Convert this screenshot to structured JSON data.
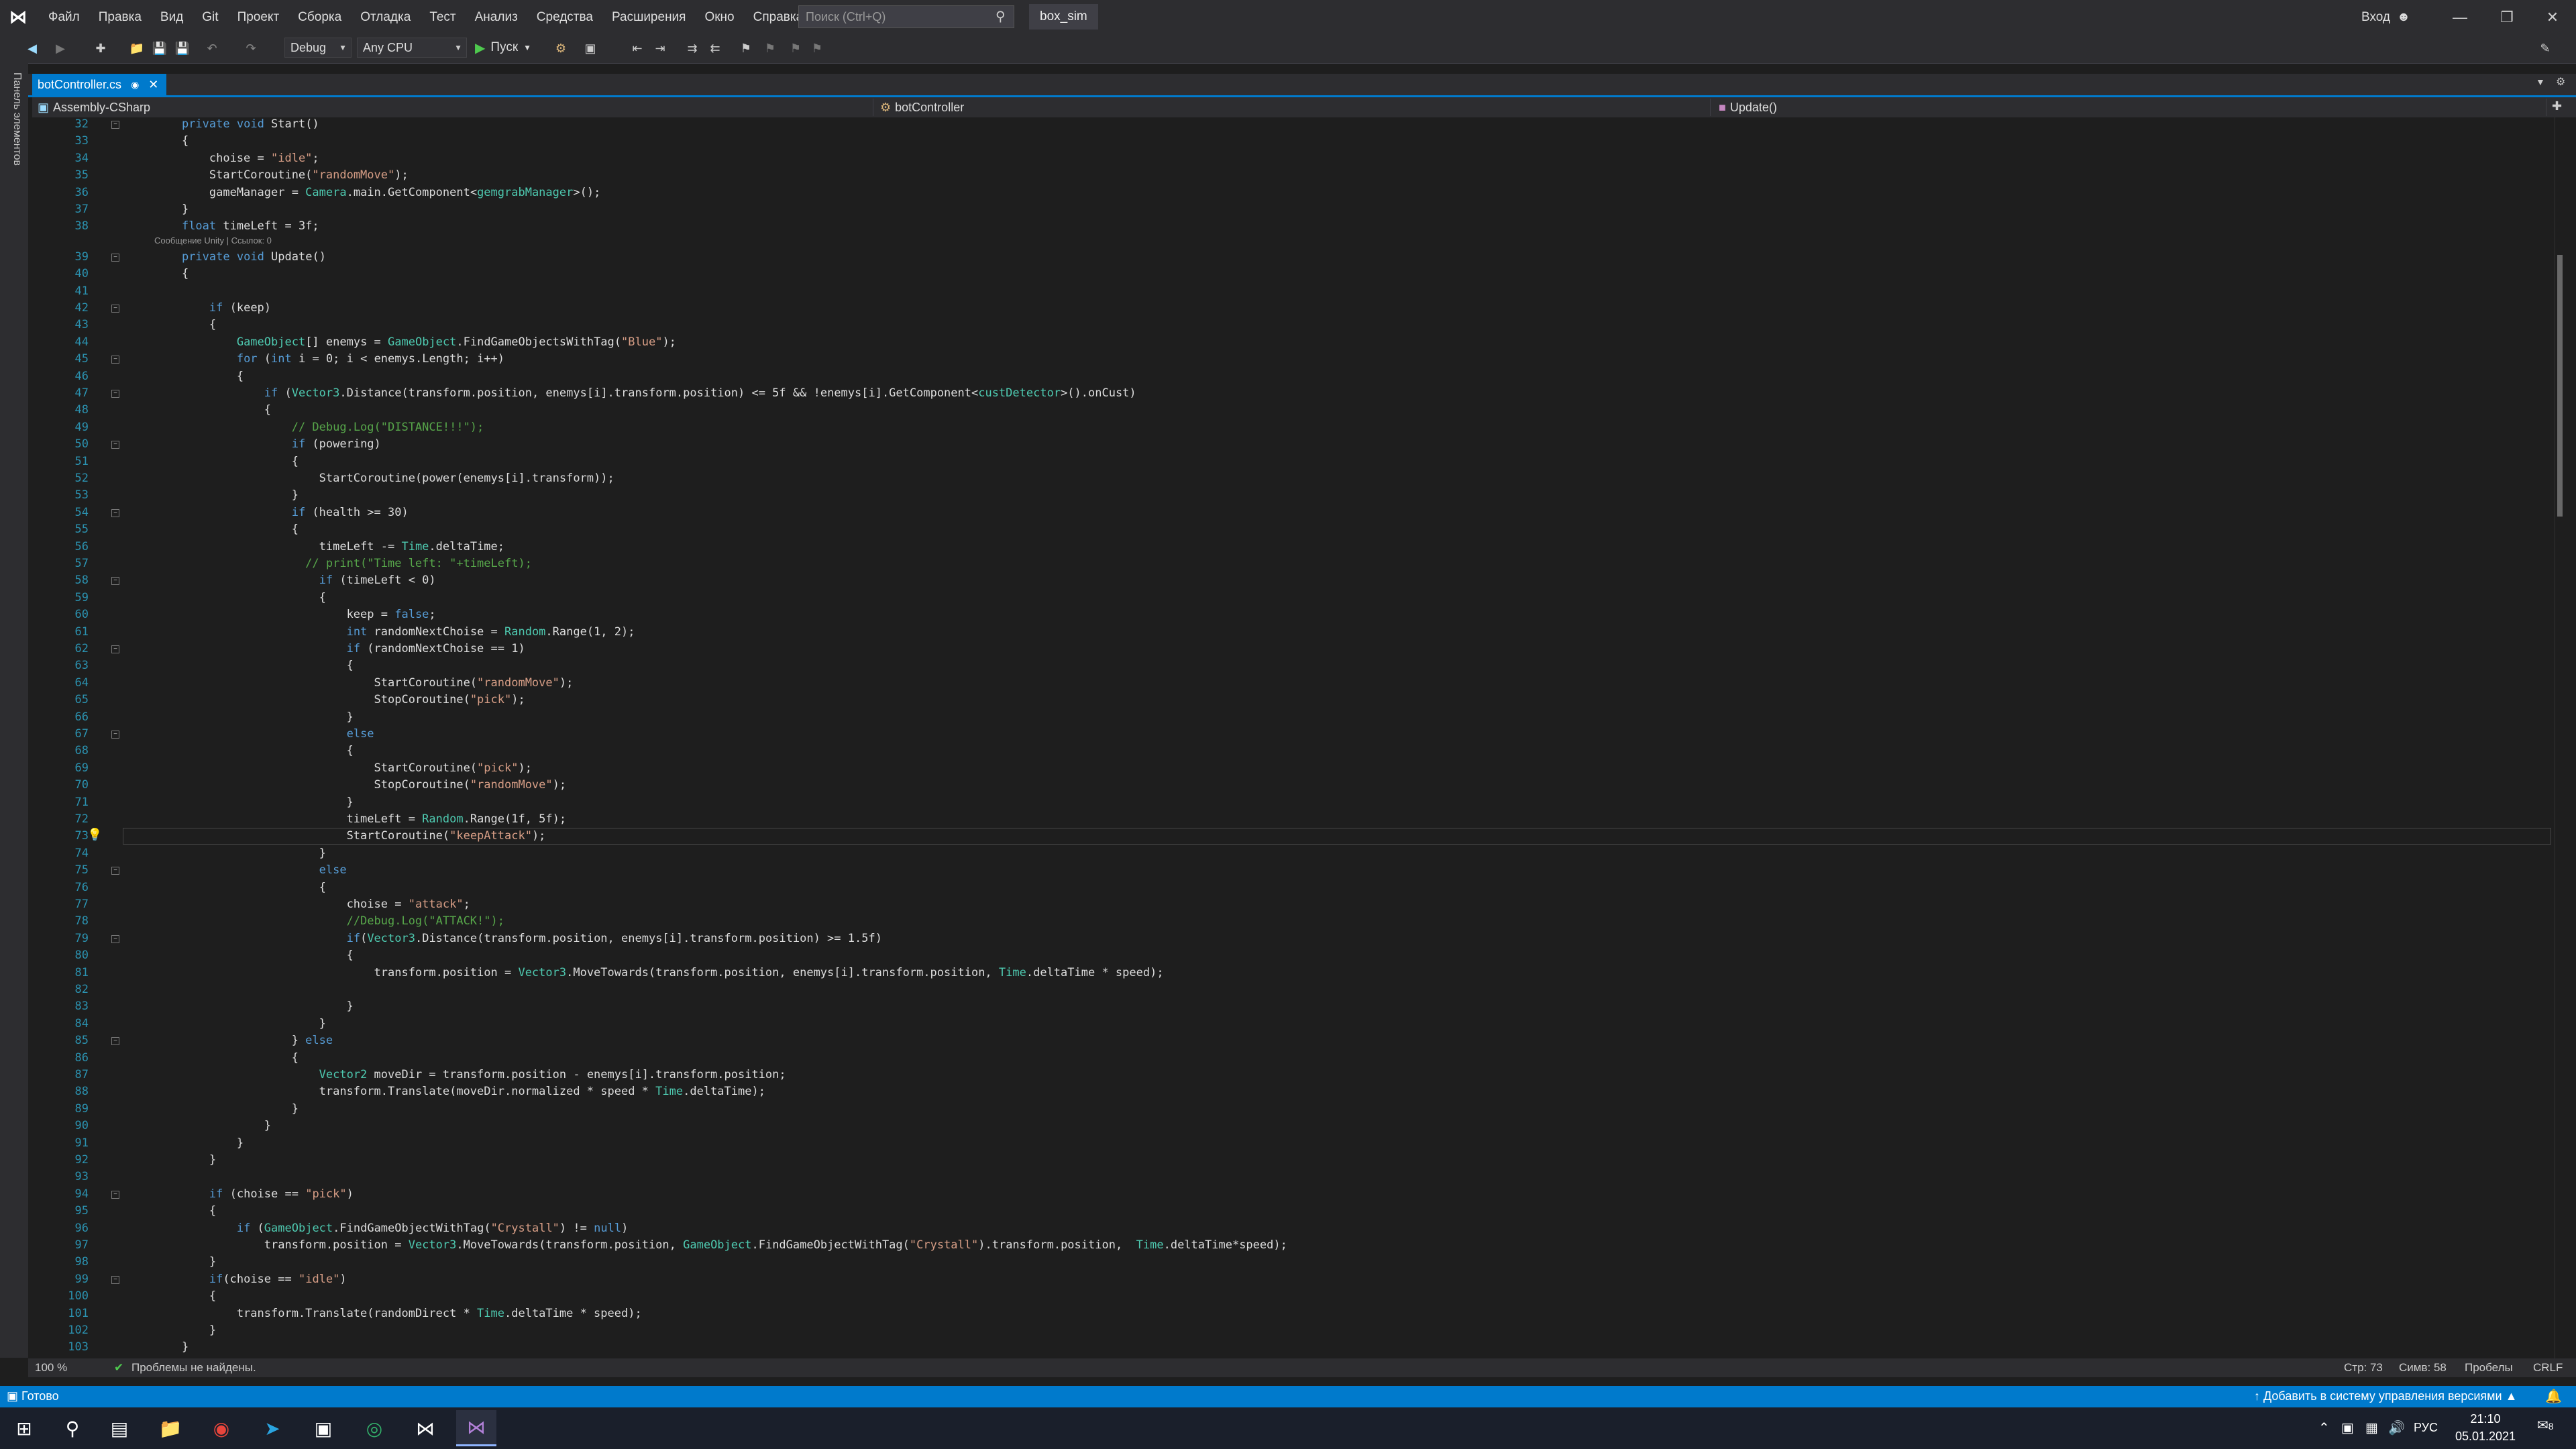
{
  "titlebar": {
    "menu": [
      "Файл",
      "Правка",
      "Вид",
      "Git",
      "Проект",
      "Сборка",
      "Отладка",
      "Тест",
      "Анализ",
      "Средства",
      "Расширения",
      "Окно",
      "Справка"
    ],
    "search_placeholder": "Поиск (Ctrl+Q)",
    "solution_name": "box_sim",
    "signin_label": "Вход"
  },
  "toolbar": {
    "config": "Debug",
    "platform": "Any CPU",
    "run_label": "Пуск"
  },
  "side_panel_label": "Панель элементов",
  "tabs": [
    {
      "label": "botController.cs",
      "active": true
    }
  ],
  "navbar": {
    "project": "Assembly-CSharp",
    "class": "botController",
    "member": "Update()"
  },
  "editor": {
    "codelens": "Сообщение Unity | Ссылок: 0",
    "current_line": 73,
    "lines": [
      {
        "n": "32",
        "t": "    private void Start()"
      },
      {
        "n": "33",
        "t": "    {"
      },
      {
        "n": "34",
        "t": "        choise = \"idle\";"
      },
      {
        "n": "35",
        "t": "        StartCoroutine(\"randomMove\");"
      },
      {
        "n": "36",
        "t": "        gameManager = Camera.main.GetComponent<gemgrabManager>();"
      },
      {
        "n": "37",
        "t": "    }"
      },
      {
        "n": "38",
        "t": "    float timeLeft = 3f;"
      },
      {
        "n": "39",
        "t": "    private void Update()"
      },
      {
        "n": "40",
        "t": "    {"
      },
      {
        "n": "41",
        "t": ""
      },
      {
        "n": "42",
        "t": "        if (keep)"
      },
      {
        "n": "43",
        "t": "        {"
      },
      {
        "n": "44",
        "t": "            GameObject[] enemys = GameObject.FindGameObjectsWithTag(\"Blue\");"
      },
      {
        "n": "45",
        "t": "            for (int i = 0; i < enemys.Length; i++)"
      },
      {
        "n": "46",
        "t": "            {"
      },
      {
        "n": "47",
        "t": "                if (Vector3.Distance(transform.position, enemys[i].transform.position) <= 5f && !enemys[i].GetComponent<custDetector>().onCust)"
      },
      {
        "n": "48",
        "t": "                {"
      },
      {
        "n": "49",
        "t": "                    // Debug.Log(\"DISTANCE!!!\");"
      },
      {
        "n": "50",
        "t": "                    if (powering)"
      },
      {
        "n": "51",
        "t": "                    {"
      },
      {
        "n": "52",
        "t": "                        StartCoroutine(power(enemys[i].transform));"
      },
      {
        "n": "53",
        "t": "                    }"
      },
      {
        "n": "54",
        "t": "                    if (health >= 30)"
      },
      {
        "n": "55",
        "t": "                    {"
      },
      {
        "n": "56",
        "t": "                        timeLeft -= Time.deltaTime;"
      },
      {
        "n": "57",
        "t": "                      // print(\"Time left: \"+timeLeft);"
      },
      {
        "n": "58",
        "t": "                        if (timeLeft < 0)"
      },
      {
        "n": "59",
        "t": "                        {"
      },
      {
        "n": "60",
        "t": "                            keep = false;"
      },
      {
        "n": "61",
        "t": "                            int randomNextChoise = Random.Range(1, 2);"
      },
      {
        "n": "62",
        "t": "                            if (randomNextChoise == 1)"
      },
      {
        "n": "63",
        "t": "                            {"
      },
      {
        "n": "64",
        "t": "                                StartCoroutine(\"randomMove\");"
      },
      {
        "n": "65",
        "t": "                                StopCoroutine(\"pick\");"
      },
      {
        "n": "66",
        "t": "                            }"
      },
      {
        "n": "67",
        "t": "                            else"
      },
      {
        "n": "68",
        "t": "                            {"
      },
      {
        "n": "69",
        "t": "                                StartCoroutine(\"pick\");"
      },
      {
        "n": "70",
        "t": "                                StopCoroutine(\"randomMove\");"
      },
      {
        "n": "71",
        "t": "                            }"
      },
      {
        "n": "72",
        "t": "                            timeLeft = Random.Range(1f, 5f);"
      },
      {
        "n": "73",
        "t": "                            StartCoroutine(\"keepAttack\");"
      },
      {
        "n": "74",
        "t": "                        }"
      },
      {
        "n": "75",
        "t": "                        else"
      },
      {
        "n": "76",
        "t": "                        {"
      },
      {
        "n": "77",
        "t": "                            choise = \"attack\";"
      },
      {
        "n": "78",
        "t": "                            //Debug.Log(\"ATTACK!\");"
      },
      {
        "n": "79",
        "t": "                            if(Vector3.Distance(transform.position, enemys[i].transform.position) >= 1.5f)"
      },
      {
        "n": "80",
        "t": "                            {"
      },
      {
        "n": "81",
        "t": "                                transform.position = Vector3.MoveTowards(transform.position, enemys[i].transform.position, Time.deltaTime * speed);"
      },
      {
        "n": "82",
        "t": ""
      },
      {
        "n": "83",
        "t": "                            }"
      },
      {
        "n": "84",
        "t": "                        }"
      },
      {
        "n": "85",
        "t": "                    } else"
      },
      {
        "n": "86",
        "t": "                    {"
      },
      {
        "n": "87",
        "t": "                        Vector2 moveDir = transform.position - enemys[i].transform.position;"
      },
      {
        "n": "88",
        "t": "                        transform.Translate(moveDir.normalized * speed * Time.deltaTime);"
      },
      {
        "n": "89",
        "t": "                    }"
      },
      {
        "n": "90",
        "t": "                }"
      },
      {
        "n": "91",
        "t": "            }"
      },
      {
        "n": "92",
        "t": "        }"
      },
      {
        "n": "93",
        "t": ""
      },
      {
        "n": "94",
        "t": "        if (choise == \"pick\")"
      },
      {
        "n": "95",
        "t": "        {"
      },
      {
        "n": "96",
        "t": "            if (GameObject.FindGameObjectWithTag(\"Crystall\") != null)"
      },
      {
        "n": "97",
        "t": "                transform.position = Vector3.MoveTowards(transform.position, GameObject.FindGameObjectWithTag(\"Crystall\").transform.position,  Time.deltaTime*speed);"
      },
      {
        "n": "98",
        "t": "        }"
      },
      {
        "n": "99",
        "t": "        if(choise == \"idle\")"
      },
      {
        "n": "100",
        "t": "        {"
      },
      {
        "n": "101",
        "t": "            transform.Translate(randomDirect * Time.deltaTime * speed);"
      },
      {
        "n": "102",
        "t": "        }"
      },
      {
        "n": "103",
        "t": "    }"
      }
    ]
  },
  "editor_status": {
    "zoom": "100 %",
    "problems": "Проблемы не найдены.",
    "line": "Стр: 73",
    "col": "Симв: 58",
    "spaces": "Пробелы",
    "eol": "CRLF"
  },
  "statusbar": {
    "ready": "Готово",
    "source_control": "Добавить в систему управления версиями"
  },
  "taskbar": {
    "language": "РУС",
    "time": "21:10",
    "date": "05.01.2021",
    "notifications": "8"
  }
}
